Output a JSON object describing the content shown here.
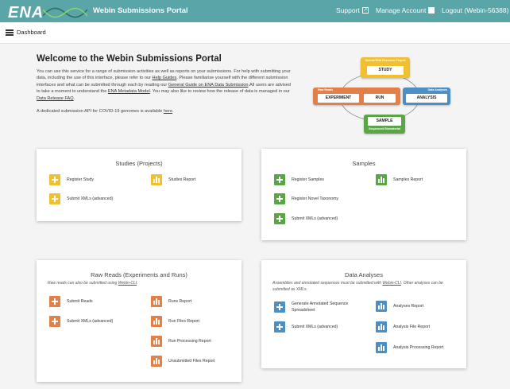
{
  "header": {
    "logo": "ENA",
    "title": "Webin Submissions Portal",
    "support": "Support",
    "manage_account": "Manage Account",
    "logout": "Logout (Webin-56388)"
  },
  "subheader": {
    "dashboard": "Dashboard"
  },
  "welcome": {
    "title": "Welcome to the Webin Submissions Portal",
    "p1": "You can use this service for a range of submission activities as well as reports on your submissions. For help with submitting your data, including the use of this interface, please refer to our ",
    "link_help": "Help Guides",
    "p2": ". Please familiarise yourself with the different submission interfaces and what can be submitted through each by reading our ",
    "link_guide": "General Guide on ENA Data Submission",
    "p3": ".All users are advised to take a moment to understand the ",
    "link_model": "ENA Metadata Model",
    "p4": ". You may also like to review how the release of data is managed in our ",
    "link_faq": "Data Release FAQ",
    "p5": ".",
    "covid_text": "A dedicated submission API for COVID-19 genomes is available ",
    "covid_link": "here",
    "covid_end": "."
  },
  "diagram": {
    "study_label": "Overall ENA Research Project",
    "study": "STUDY",
    "reads_label": "Raw Reads",
    "experiment": "EXPERIMENT",
    "run": "RUN",
    "analysis_label": "Data Analyses",
    "analysis": "ANALYSIS",
    "sample": "SAMPLE",
    "sample_label": "Sequenced Biomaterial"
  },
  "cards": {
    "studies": {
      "title": "Studies (Projects)",
      "register": "Register Study",
      "xml": "Submit XMLs (advanced)",
      "report": "Studies Report"
    },
    "samples": {
      "title": "Samples",
      "register": "Register Samples",
      "taxonomy": "Register Novel Taxonomy",
      "xml": "Submit XMLs (advanced)",
      "report": "Samples Report"
    },
    "reads": {
      "title": "Raw Reads (Experiments and Runs)",
      "subtitle_pre": "Raw reads can also be submitted using ",
      "subtitle_link": "Webin-CLI",
      "subtitle_post": ".",
      "submit": "Submit Reads",
      "xml": "Submit XMLs (advanced)",
      "runs": "Runs Report",
      "run_files": "Run Files Report",
      "run_processing": "Run Processing Report",
      "unsubmitted": "Unsubmitted Files Report"
    },
    "analyses": {
      "title": "Data Analyses",
      "subtitle_pre": "Assemblies and annotated sequences must be submitted with ",
      "subtitle_link": "Webin-CLI",
      "subtitle_post": ". Other analyses can be submitted as XMLs.",
      "generate": "Generate Annotated Sequence Spreadsheet",
      "xml": "Submit XMLs (advanced)",
      "analyses_report": "Analyses Report",
      "analysis_file": "Analysis File Report",
      "analysis_processing": "Analysis Processing Report"
    }
  },
  "colors": {
    "header": "#5aa5a8",
    "studies": "#f0c030",
    "samples": "#5aa646",
    "reads": "#e2804a",
    "analyses": "#4d8fc5"
  }
}
